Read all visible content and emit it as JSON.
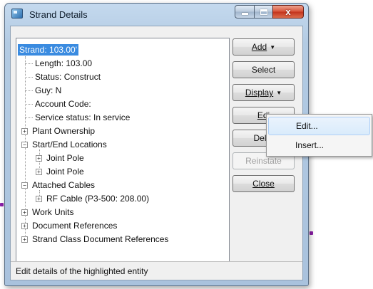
{
  "window": {
    "title": "Strand Details",
    "status_text": "Edit details of the highlighted entity"
  },
  "title_buttons": {
    "minimize": "minimize",
    "maximize": "maximize",
    "close": "x"
  },
  "tree": {
    "root": "Strand: 103.00'",
    "length": "Length: 103.00",
    "status": "Status: Construct",
    "guy": "Guy: N",
    "account_code": "Account Code:",
    "service_status": "Service status: In service",
    "plant_ownership": "Plant Ownership",
    "start_end_locations": "Start/End Locations",
    "joint_pole_1": "Joint Pole",
    "joint_pole_2": "Joint Pole",
    "attached_cables": "Attached Cables",
    "rf_cable": "RF Cable (P3-500: 208.00)",
    "work_units": "Work Units",
    "document_references": "Document References",
    "strand_class_document_references": "Strand Class Document References"
  },
  "buttons": {
    "add": "Add",
    "select": "Select",
    "display": "Display",
    "edit": "Edi",
    "delete": "Delet",
    "reinstate": "Reinstate",
    "close": "Close"
  },
  "edit_menu": {
    "edit": "Edit...",
    "insert": "Insert..."
  },
  "colors": {
    "selection": "#3a8be0",
    "title_bar": "#b3cbe3",
    "close_button": "#c3331c"
  },
  "icons": {
    "expander": "plus-box-icon",
    "collapser": "minus-box-icon"
  }
}
